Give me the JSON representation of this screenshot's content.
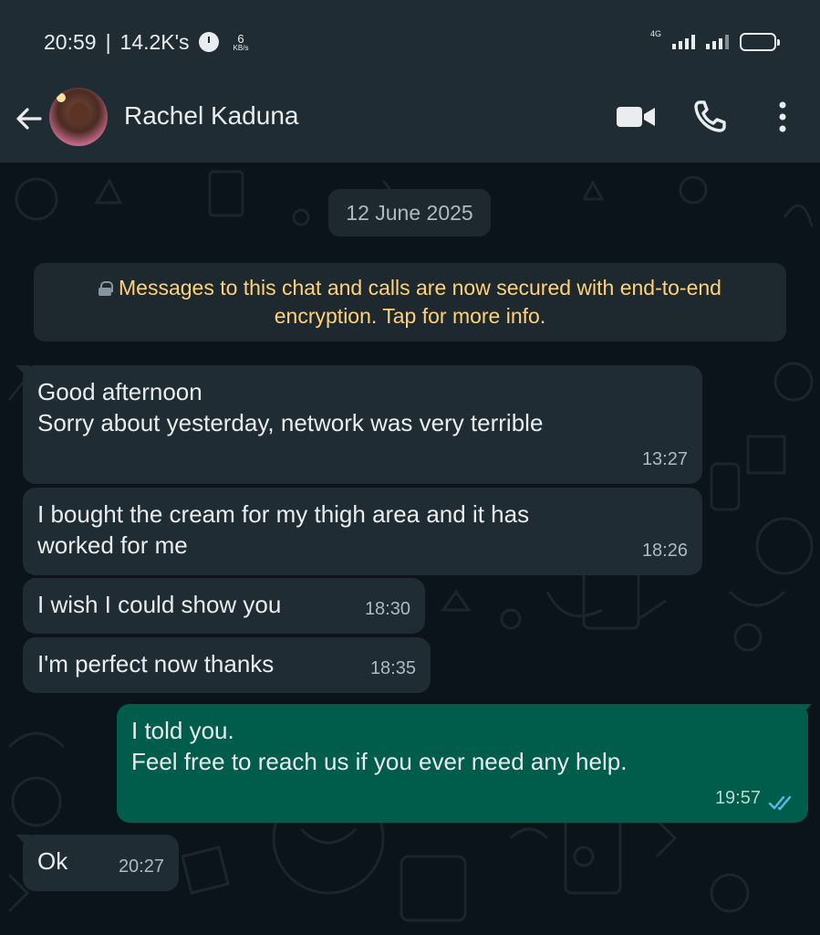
{
  "status_bar": {
    "time": "20:59",
    "separator": "|",
    "data_usage": "14.2K's",
    "speed_value": "6",
    "speed_unit": "KB/s",
    "network": "4G"
  },
  "header": {
    "contact_name": "Rachel Kaduna"
  },
  "chat": {
    "date_chip": "12 June 2025",
    "encryption_note": "Messages to this chat and calls are now secured with end-to-end encryption. Tap for more info.",
    "messages": [
      {
        "direction": "in",
        "text": "Good afternoon\nSorry about yesterday, network was very terrible",
        "time": "13:27"
      },
      {
        "direction": "in",
        "text": "I bought the cream for my thigh area and it has\nworked for me",
        "time": "18:26"
      },
      {
        "direction": "in",
        "text": "I wish I could show you",
        "time": "18:30"
      },
      {
        "direction": "in",
        "text": "I'm perfect now thanks",
        "time": "18:35"
      },
      {
        "direction": "out",
        "text": "I told you.\nFeel free to reach us if you ever need any help.",
        "time": "19:57",
        "status": "read"
      },
      {
        "direction": "in",
        "text": "Ok",
        "time": "20:27"
      }
    ]
  },
  "colors": {
    "header_bg": "#1f2c33",
    "chat_bg": "#0b141a",
    "incoming_bubble": "#202c33",
    "outgoing_bubble": "#005c4b",
    "encryption_text": "#ffd279",
    "read_tick": "#53bdeb"
  },
  "icons": {
    "back": "arrow-left-icon",
    "video_call": "video-camera-icon",
    "voice_call": "phone-icon",
    "menu": "more-vertical-icon",
    "lock": "lock-icon",
    "read_status": "double-check-icon"
  }
}
